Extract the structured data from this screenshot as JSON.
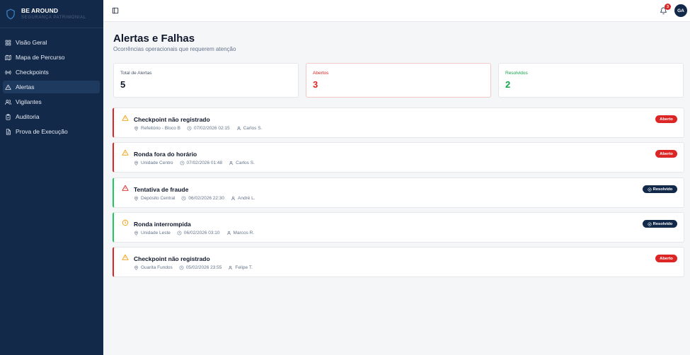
{
  "brand": {
    "name": "BE AROUND",
    "subtitle": "SEGURANÇA PATRIMONIAL"
  },
  "sidebar": {
    "items": [
      {
        "label": "Visão Geral",
        "icon": "dashboard-icon"
      },
      {
        "label": "Mapa de Percurso",
        "icon": "map-icon"
      },
      {
        "label": "Checkpoints",
        "icon": "radio-icon"
      },
      {
        "label": "Alertas",
        "icon": "alert-triangle-icon",
        "active": true
      },
      {
        "label": "Vigilantes",
        "icon": "users-icon"
      },
      {
        "label": "Auditoria",
        "icon": "clipboard-icon"
      },
      {
        "label": "Prova de Execução",
        "icon": "file-icon"
      }
    ]
  },
  "topbar": {
    "notifications": "3",
    "avatar": "GA"
  },
  "page": {
    "title": "Alertas e Falhas",
    "subtitle": "Ocorrências operacionais que requerem atenção"
  },
  "stats": {
    "total": {
      "label": "Total de Alertas",
      "value": "5"
    },
    "open": {
      "label": "Abertos",
      "value": "3"
    },
    "solved": {
      "label": "Resolvidos",
      "value": "2"
    }
  },
  "alerts": [
    {
      "title": "Checkpoint não registrado",
      "location": "Refeitório - Bloco B",
      "datetime": "07/02/2026 02:15",
      "person": "Carlos S.",
      "status": "Aberto",
      "icon": "warning-icon"
    },
    {
      "title": "Ronda fora do horário",
      "location": "Unidade Centro",
      "datetime": "07/02/2026 01:48",
      "person": "Carlos S.",
      "status": "Aberto",
      "icon": "warning-icon"
    },
    {
      "title": "Tentativa de fraude",
      "location": "Depósito Central",
      "datetime": "06/02/2026 22:30",
      "person": "André L.",
      "status": "Resolvido",
      "icon": "danger-icon"
    },
    {
      "title": "Ronda interrompida",
      "location": "Unidade Leste",
      "datetime": "06/02/2026 03:10",
      "person": "Marcos R.",
      "status": "Resolvido",
      "icon": "clock-icon"
    },
    {
      "title": "Checkpoint não registrado",
      "location": "Guarita Fundos",
      "datetime": "05/02/2026 23:55",
      "person": "Felipe T.",
      "status": "Aberto",
      "icon": "warning-icon"
    }
  ],
  "colors": {
    "sidebar": "#13294a",
    "open": "#dc2626",
    "resolved": "#22c55e",
    "warning": "#f59e0b"
  }
}
